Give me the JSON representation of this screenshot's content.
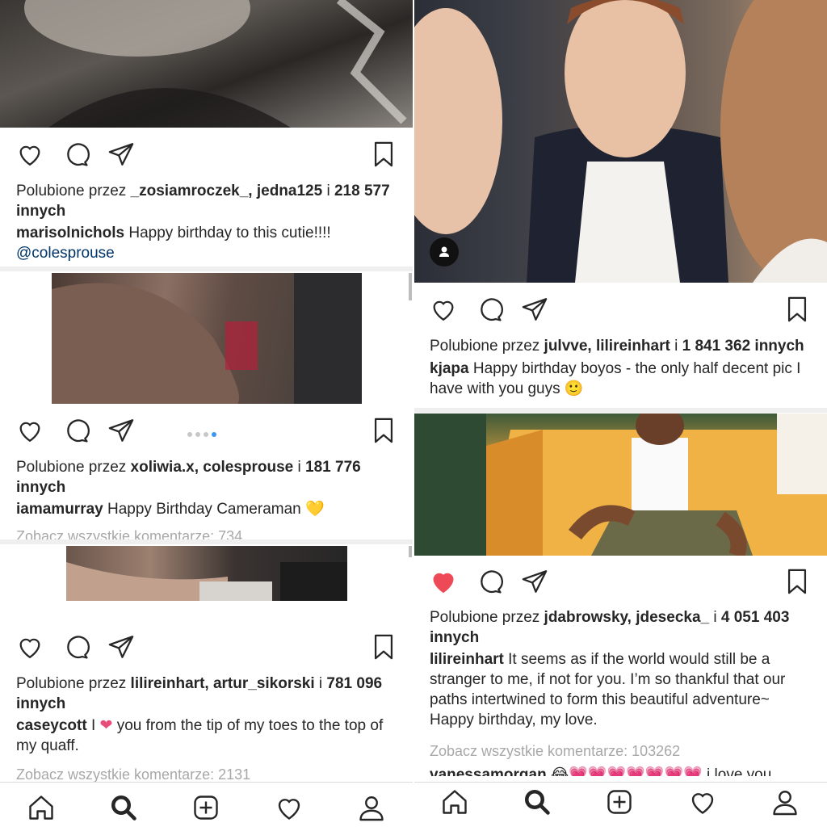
{
  "left": {
    "post1": {
      "likes_prefix": "Polubione przez ",
      "likes_users": "_zosiamroczek_, jedna125",
      "likes_mid": " i ",
      "likes_count": "218 577",
      "likes_suffix": "innych",
      "caption_user": "marisolnichols",
      "caption_text": " Happy birthday to this cutie!!!!",
      "mention": "@colesprouse"
    },
    "post2": {
      "likes_prefix": "Polubione przez ",
      "likes_users": "xoliwia.x, colesprouse",
      "likes_mid": " i ",
      "likes_count": "181 776",
      "likes_suffix": "innych",
      "caption_user": "iamamurray",
      "caption_text": " Happy Birthday Cameraman ",
      "caption_emoji": "💛",
      "more": "Zobacz wszystkie komentarze: 734"
    },
    "post3": {
      "likes_prefix": "Polubione przez ",
      "likes_users": "lilireinhart, artur_sikorski",
      "likes_mid": " i ",
      "likes_count": "781 096",
      "likes_suffix": "innych",
      "caption_user": "caseycott",
      "caption_text_a": " I ",
      "caption_emoji": "❤",
      "caption_text_b": " you from the tip of my toes to the top of my quaff.",
      "more": "Zobacz wszystkie komentarze: 2131"
    }
  },
  "right": {
    "post1": {
      "likes_prefix": "Polubione przez ",
      "likes_users": "julvve, lilireinhart",
      "likes_mid": " i ",
      "likes_count": "1 841 362 innych",
      "caption_user": "kjapa",
      "caption_text": " Happy birthday boyos - the only half decent pic I have with you guys ",
      "caption_emoji": "🙂"
    },
    "post2": {
      "likes_prefix": "Polubione przez ",
      "likes_users": "jdabrowsky, jdesecka_",
      "likes_mid": " i ",
      "likes_count": "4 051 403",
      "likes_suffix": "innych",
      "caption_user": "lilireinhart",
      "caption_text": " It seems as if the world would still be a stranger to me, if not for you. I’m so thankful that our paths intertwined to form this beautiful adventure~ Happy birthday, my love.",
      "more": "Zobacz wszystkie komentarze: 103262",
      "next_comment_user": "vanessamorgan",
      "next_comment_text": " 😂💗💗💗💗💗💗💗 i love you"
    }
  },
  "icons": {
    "like": "heart-icon",
    "liked": "heart-filled-icon",
    "comment": "comment-icon",
    "share": "send-icon",
    "save": "bookmark-icon",
    "nav": [
      "home-icon",
      "search-icon",
      "add-post-icon",
      "activity-heart-icon",
      "profile-icon"
    ]
  },
  "colors": {
    "liked_red": "#ed4956",
    "link_blue": "#003569",
    "muted": "#a8a8a8",
    "dot_active": "#3897f0"
  }
}
